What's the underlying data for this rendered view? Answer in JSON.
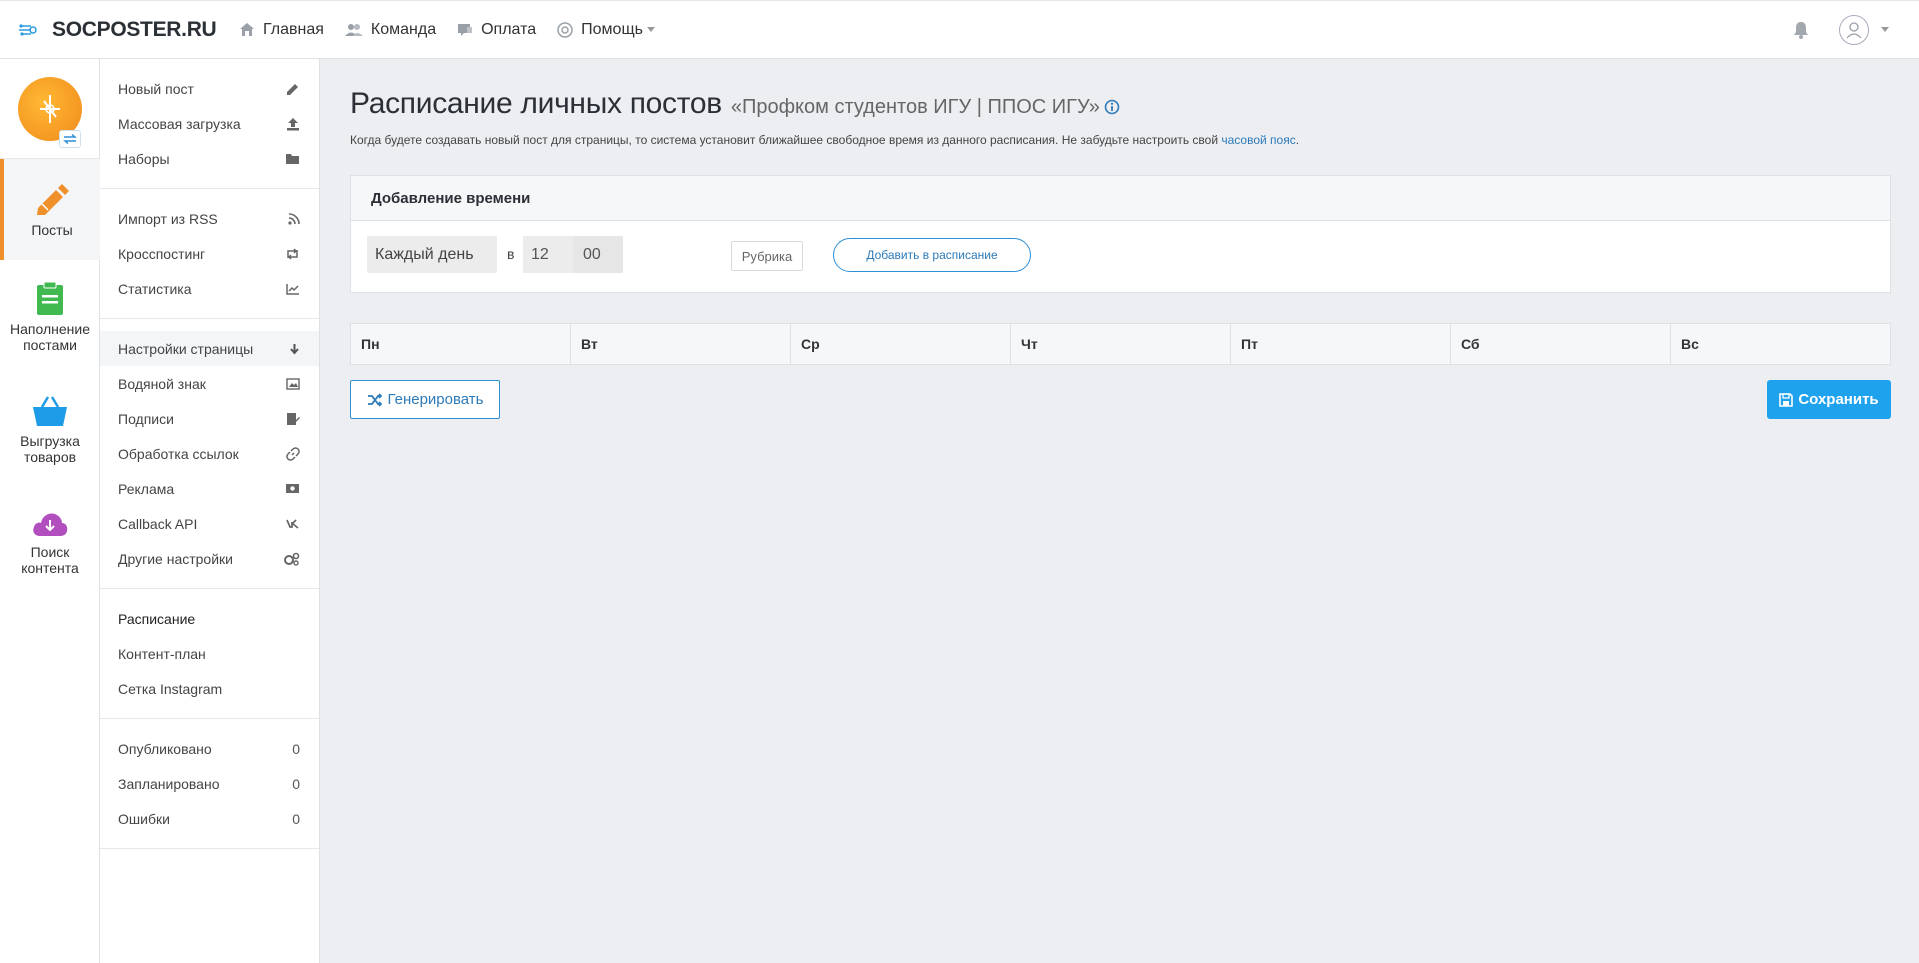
{
  "brand": {
    "name": "SOCPOSTER.RU"
  },
  "topnav": [
    {
      "label": "Главная",
      "icon": "home-icon"
    },
    {
      "label": "Команда",
      "icon": "team-icon"
    },
    {
      "label": "Оплата",
      "icon": "payment-icon"
    },
    {
      "label": "Помощь",
      "icon": "help-icon"
    }
  ],
  "rail": [
    {
      "label": "Посты",
      "icon": "pencil-icon",
      "color": "#f0902a"
    },
    {
      "label": "Наполнение постами",
      "icon": "clipboard-icon",
      "color": "#3fb950"
    },
    {
      "label": "Выгрузка товаров",
      "icon": "basket-icon",
      "color": "#1e9ce8"
    },
    {
      "label": "Поиск контента",
      "icon": "cloud-download-icon",
      "color": "#b24fbf"
    }
  ],
  "side": {
    "group1": [
      "Новый пост",
      "Массовая загрузка",
      "Наборы"
    ],
    "group2": [
      "Импорт из RSS",
      "Кросспостинг",
      "Статистика"
    ],
    "group3": [
      "Настройки страницы",
      "Водяной знак",
      "Подписи",
      "Обработка ссылок",
      "Реклама",
      "Callback API",
      "Другие настройки"
    ],
    "group4": [
      "Расписание",
      "Контент-план",
      "Сетка Instagram"
    ],
    "group5": [
      {
        "label": "Опубликовано",
        "count": "0"
      },
      {
        "label": "Запланировано",
        "count": "0"
      },
      {
        "label": "Ошибки",
        "count": "0"
      }
    ]
  },
  "page": {
    "title": "Расписание личных постов",
    "subtitle": "«Профком студентов ИГУ | ППОС ИГУ»",
    "desc_before": "Когда будете создавать новый пост для страницы, то система установит ближайшее свободное время из данного расписания. Не забудьте настроить свой ",
    "desc_link": "часовой пояс",
    "desc_after": "."
  },
  "add_time": {
    "heading": "Добавление времени",
    "day_value": "Каждый день",
    "at": "в",
    "hour": "12",
    "minute": "00",
    "rubric": "Рубрика",
    "add_button": "Добавить в расписание"
  },
  "days": [
    "Пн",
    "Вт",
    "Ср",
    "Чт",
    "Пт",
    "Сб",
    "Вс"
  ],
  "actions": {
    "generate": "Генерировать",
    "save": "Сохранить"
  },
  "colors": {
    "accent": "#1fa2ee",
    "link": "#2d7ab8",
    "active": "#f0902a"
  }
}
